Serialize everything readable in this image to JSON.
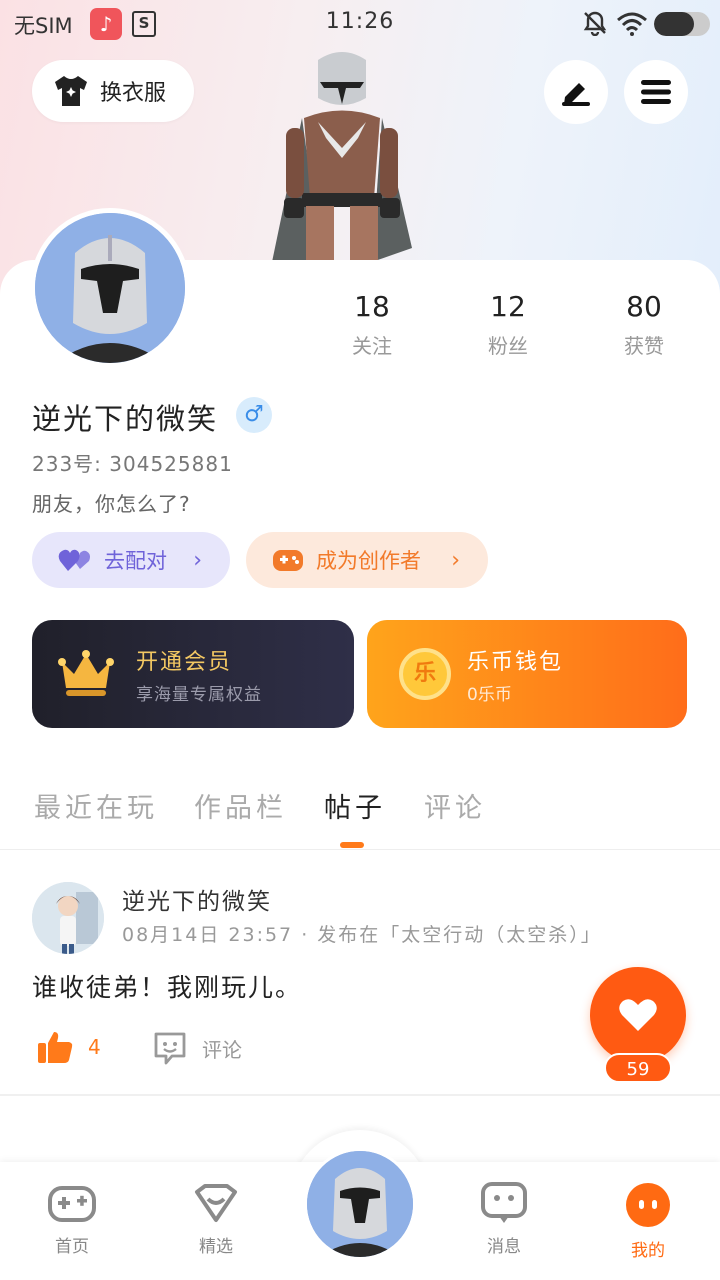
{
  "status_bar": {
    "carrier": "无SIM",
    "time": "11:26",
    "app_icons": [
      "music-app-icon",
      "s-app-icon"
    ]
  },
  "header": {
    "outfit_label": "换衣服",
    "edit_icon": "edit-icon",
    "menu_icon": "menu-icon"
  },
  "profile": {
    "stats": [
      {
        "value": "18",
        "label": "关注"
      },
      {
        "value": "12",
        "label": "粉丝"
      },
      {
        "value": "80",
        "label": "获赞"
      }
    ],
    "name": "逆光下的微笑",
    "gender_symbol": "♂",
    "uid": "233号: 304525881",
    "bio": "朋友，你怎么了?",
    "match_label": "去配对",
    "creator_label": "成为创作者"
  },
  "promo": {
    "vip_title": "开通会员",
    "vip_subtitle": "享海量专属权益",
    "wallet_title": "乐币钱包",
    "wallet_subtitle": "0乐币",
    "coin_glyph": "乐"
  },
  "tabs": [
    "最近在玩",
    "作品栏",
    "帖子",
    "评论"
  ],
  "active_tab": 2,
  "post": {
    "author": "逆光下的微笑",
    "meta": "08月14日 23:57 · 发布在「太空行动（太空杀）」",
    "body": "谁收徒弟！我刚玩儿。",
    "like_count": "4",
    "comment_label": "评论"
  },
  "fab": {
    "count": "59"
  },
  "bottom_nav": [
    {
      "label": "首页",
      "icon": "gamepad-icon"
    },
    {
      "label": "精选",
      "icon": "heart-bag-icon"
    },
    {
      "label": "",
      "icon": "avatar-center"
    },
    {
      "label": "消息",
      "icon": "message-icon"
    },
    {
      "label": "我的",
      "icon": "profile-icon"
    }
  ],
  "colors": {
    "accent": "#ff6a12",
    "vip_gold": "#f3c863",
    "match_purple": "#6f63d9"
  }
}
